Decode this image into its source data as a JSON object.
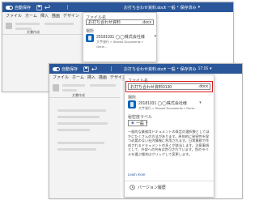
{
  "back_window": {
    "autosave_label": "自動保存",
    "file_title": "お打ち合わせ資料.docx",
    "title_separator": "•",
    "sensitivity_label": "一般",
    "save_status": "保存済み",
    "ribbon_tabs": [
      "ファイル",
      "ホーム",
      "挿入",
      "描画",
      "デザイン"
    ],
    "ribbon_group": "文書作成",
    "panel": {
      "filename_label": "ファイル名",
      "filename_value": "お打ち合わせ資料",
      "filename_ext": ".docx",
      "location_label": "場所",
      "location_name": "20181031 ◯◯株式会社様",
      "location_path": "大芋発行 » Shared Documents » Gene..."
    }
  },
  "front_window": {
    "autosave_label": "自動保存",
    "file_title": "お打ち合わせ資料.docx",
    "title_separator": "•",
    "sensitivity_label": "一般",
    "save_status": "保存済み",
    "time": "17:16",
    "ribbon_tabs": [
      "ファイル",
      "ホーム",
      "挿入",
      "描画",
      "デザイン"
    ],
    "ribbon_group": "文書作成",
    "panel": {
      "filename_label": "ファイル名",
      "filename_value": "お打ち合わせ資料0130",
      "filename_ext": ".docx",
      "location_label": "場所",
      "location_name": "20181031 ◯◯株式会社様",
      "location_path": "大芋発行 » Shared Documents » Gene...",
      "sensitivity_label": "秘密度ラベル",
      "sensitivity_value": "一般",
      "description": "一般的な業務用ドキュメントの既定の選択肢としてほかにたくさんの方法があります。原則的に秘密性を保つ必要のない社内情報に利用されます。日常業務で作成されるドキュメントの多くが該当します。注意事項として、外部への共有は許可されています。別のラベルを選ぶ場合はクリックして変更します。",
      "learn_more": "Learn more",
      "version_history": "バージョン履歴"
    }
  },
  "colors": {
    "titlebar": "#2b579a",
    "highlight": "#d81c1c",
    "onedrive_blue": "#0364b8"
  }
}
